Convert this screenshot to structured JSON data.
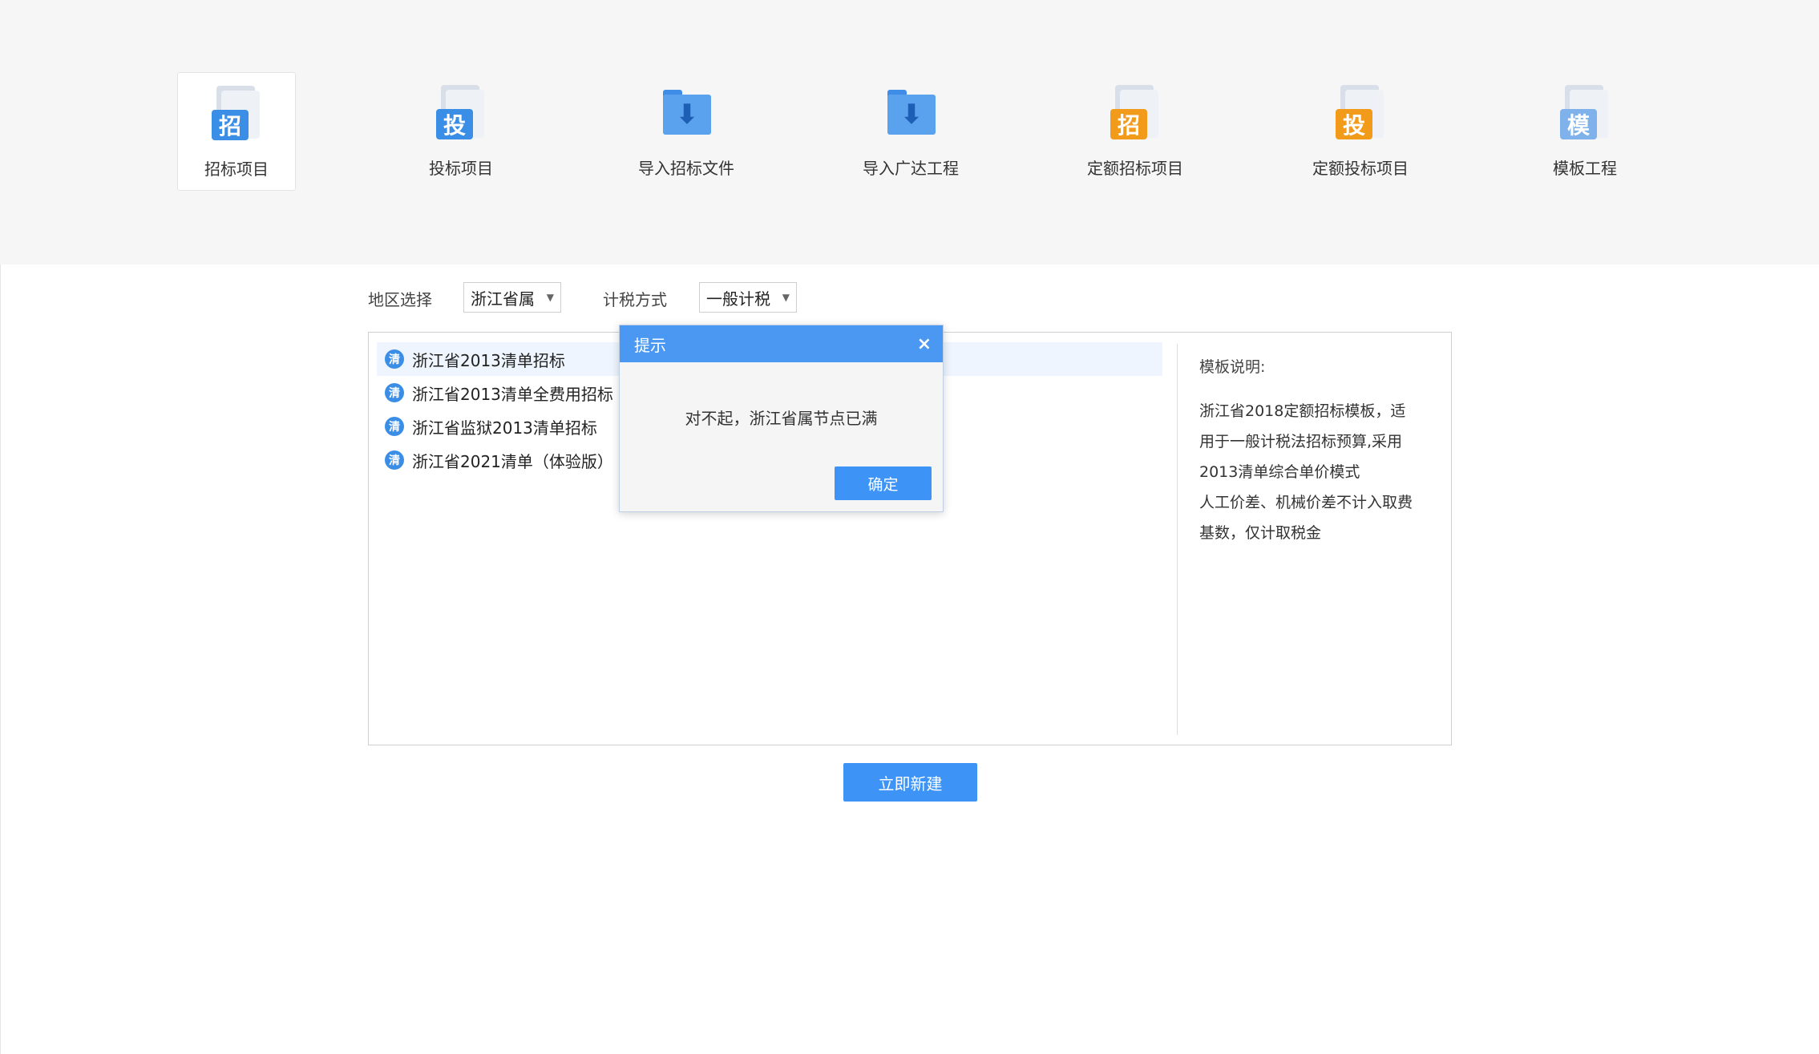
{
  "toolbar": {
    "tiles": [
      {
        "label": "招标项目",
        "icon": "zhao-doc-icon",
        "badge": "招"
      },
      {
        "label": "投标项目",
        "icon": "tou-doc-icon",
        "badge": "投"
      },
      {
        "label": "导入招标文件",
        "icon": "folder-download-icon"
      },
      {
        "label": "导入广达工程",
        "icon": "folder-download-icon"
      },
      {
        "label": "定额招标项目",
        "icon": "zhao-doc-orange-icon",
        "badge": "招"
      },
      {
        "label": "定额投标项目",
        "icon": "tou-doc-orange-icon",
        "badge": "投"
      },
      {
        "label": "模板工程",
        "icon": "mo-doc-icon",
        "badge": "模"
      }
    ]
  },
  "filters": {
    "region_label": "地区选择",
    "region_value": "浙江省属",
    "tax_label": "计税方式",
    "tax_value": "一般计税"
  },
  "templates": {
    "badge": "清",
    "items": [
      "浙江省2013清单招标",
      "浙江省2013清单全费用招标",
      "浙江省监狱2013清单招标",
      "浙江省2021清单（体验版）"
    ]
  },
  "description": {
    "title": "模板说明:",
    "lines": [
      "浙江省2018定额招标模板，适",
      "用于一般计税法招标预算,采用",
      "2013清单综合单价模式",
      "人工价差、机械价差不计入取费",
      "基数，仅计取税金"
    ]
  },
  "create_button": "立即新建",
  "dialog": {
    "title": "提示",
    "close": "×",
    "message": "对不起，浙江省属节点已满",
    "ok": "确定"
  },
  "colors": {
    "accent": "#3d94f6",
    "orange": "#f29b1b",
    "band": "#f6f6f6"
  }
}
